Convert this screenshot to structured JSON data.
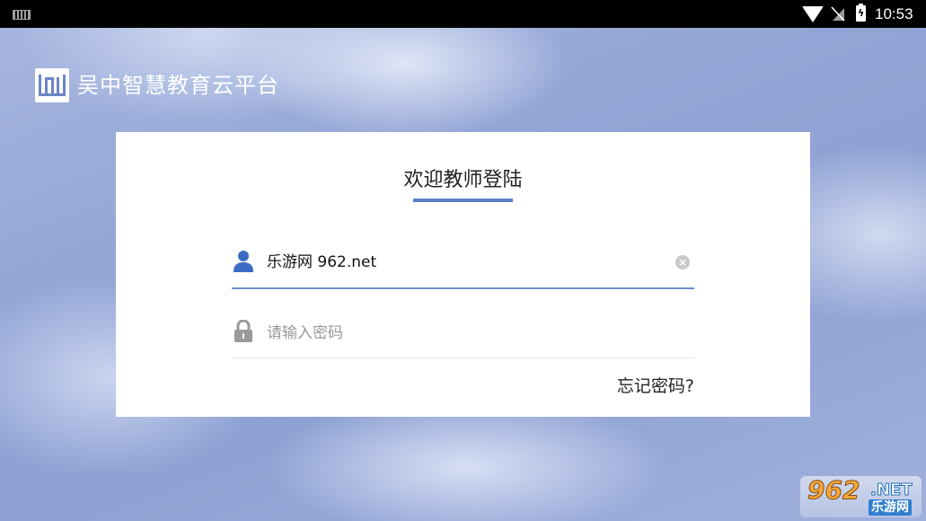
{
  "status_bar": {
    "time": "10:53",
    "icons": [
      "keyboard-icon",
      "wifi-icon",
      "no-signal-icon",
      "battery-charging-icon"
    ]
  },
  "header": {
    "app_title": "吴中智慧教育云平台",
    "logo_icon": "book-logo-icon"
  },
  "login": {
    "title": "欢迎教师登陆",
    "username": {
      "value": "乐游网 962.net",
      "icon": "user-icon",
      "clear_icon": "clear-icon"
    },
    "password": {
      "placeholder": "请输入密码",
      "icon": "lock-icon"
    },
    "forgot_password": "忘记密码?"
  },
  "watermark": {
    "number": "962",
    "domain": ".NET",
    "name": "乐游网"
  },
  "colors": {
    "accent": "#5b7fc7",
    "field_underline": "#6d8fd2",
    "icon_blue": "#3a6cc4",
    "icon_gray": "#9a9a9a"
  }
}
